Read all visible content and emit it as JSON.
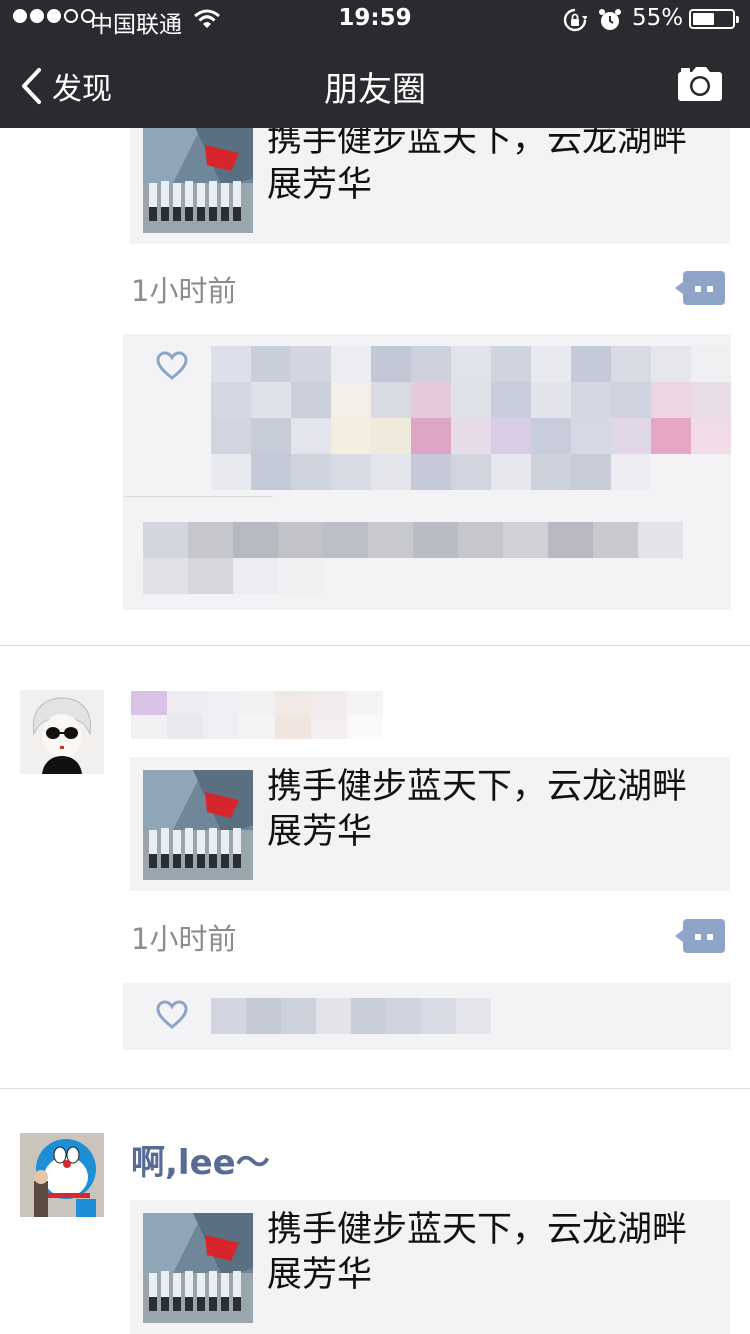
{
  "status_bar": {
    "carrier": "中国联通",
    "time": "19:59",
    "battery": "55%",
    "battery_level": 0.55
  },
  "nav": {
    "back_label": "发现",
    "title": "朋友圈"
  },
  "posts": [
    {
      "link_title": "携手健步蓝天下，云龙湖畔展芳华",
      "time_ago": "1小时前"
    },
    {
      "link_title": "携手健步蓝天下，云龙湖畔展芳华",
      "time_ago": "1小时前"
    },
    {
      "author": "啊,lee～",
      "link_title": "携手健步蓝天下，云龙湖畔展芳华"
    }
  ],
  "colors": {
    "nav_bg": "#2b2b2f",
    "author_name": "#576b95",
    "card_bg": "#f3f3f5",
    "comment_button": "#8ea4c8"
  },
  "icons": [
    "signal-dots-icon",
    "wifi-icon",
    "rotation-lock-icon",
    "alarm-icon",
    "battery-icon",
    "back-chevron-icon",
    "camera-icon",
    "comment-icon",
    "heart-icon"
  ]
}
